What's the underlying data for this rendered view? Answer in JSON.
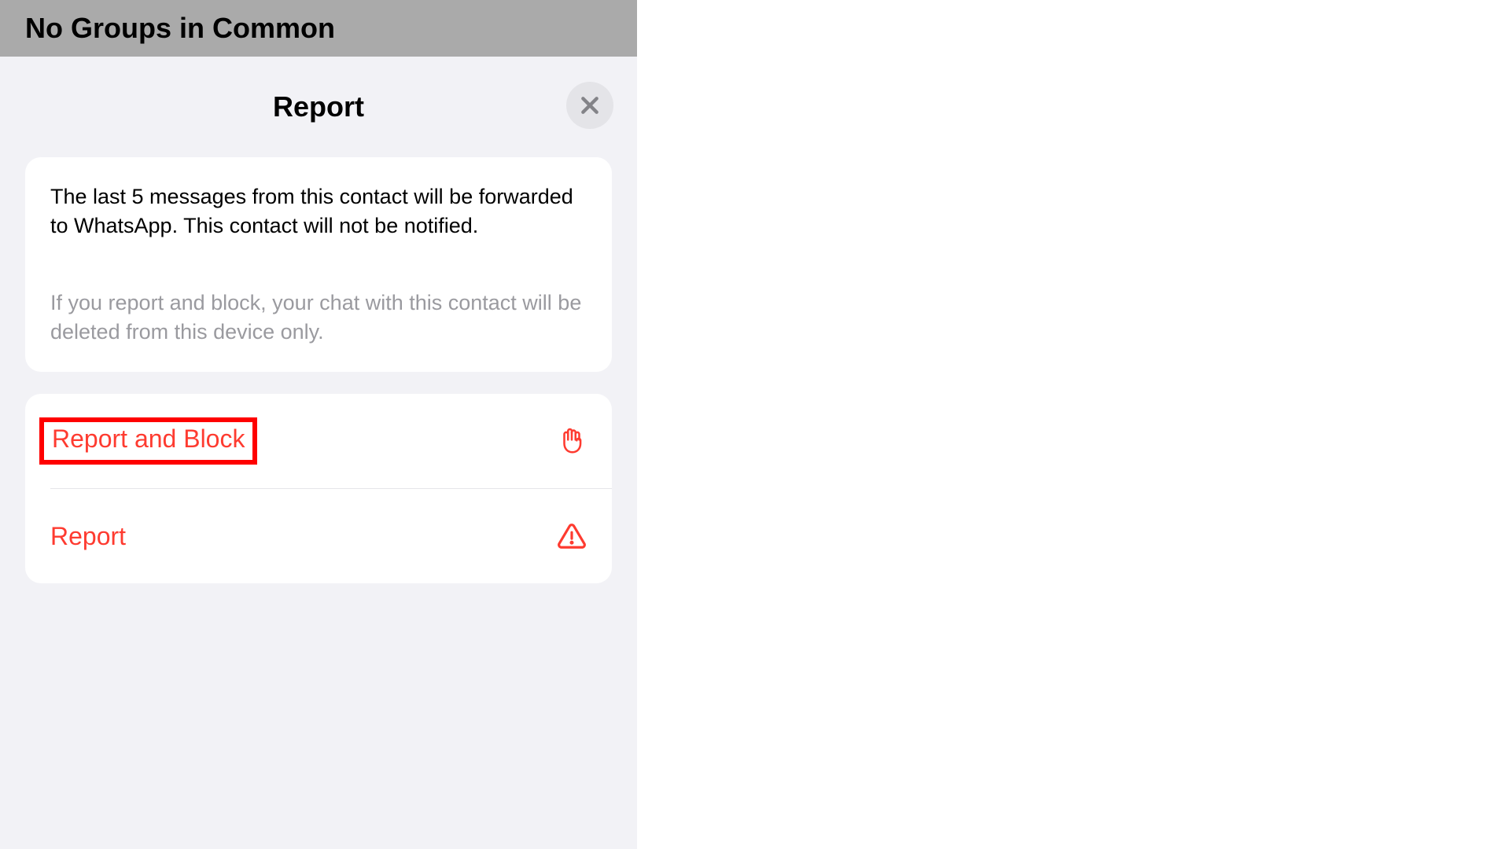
{
  "backdrop": {
    "title": "No Groups in Common"
  },
  "sheet": {
    "title": "Report",
    "info_primary": "The last 5 messages from this contact will be forwarded to WhatsApp. This contact will not be notified.",
    "info_secondary": "If you report and block, your chat with this contact will be deleted from this device only.",
    "actions": {
      "report_and_block": "Report and Block",
      "report": "Report"
    }
  },
  "colors": {
    "destructive": "#fe3b30",
    "highlight": "#ff0000"
  }
}
